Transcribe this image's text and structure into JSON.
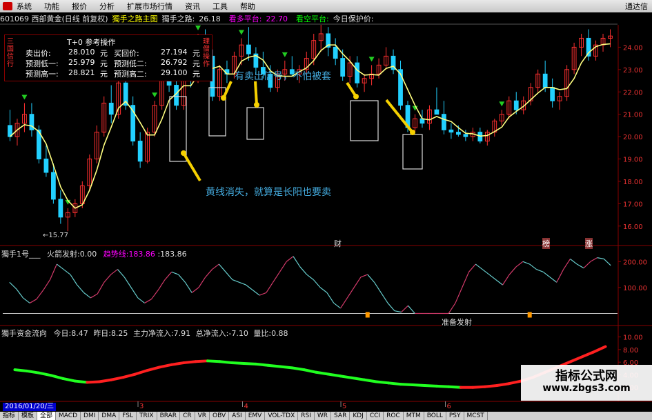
{
  "menu": {
    "items": [
      "系统",
      "功能",
      "报价",
      "分析",
      "扩展市场行情",
      "资讯",
      "工具",
      "帮助"
    ],
    "brand": "通达信"
  },
  "header": {
    "code_name": "601069 西部黄金(日线 前复权)",
    "main_label": "獨手之路主图",
    "main_value_label": "獨手之路:",
    "main_value": "26.18",
    "long_label": "看多平台:",
    "long_value": "22.70",
    "short_label": "看空平台:",
    "protect_label": "今日保护价:"
  },
  "panel": {
    "title": "T+0 参考操作",
    "left_vertical": "三国信行",
    "right_vertical": "理僧操作",
    "rows": [
      {
        "l_label": "卖出价:",
        "l_value": "28.010",
        "l_unit": "元",
        "r_label": "买回价:",
        "r_value": "27.194",
        "r_unit": "元"
      },
      {
        "l_label": "预测低一:",
        "l_value": "25.979",
        "l_unit": "元",
        "r_label": "预测低二:",
        "r_value": "26.792",
        "r_unit": "元"
      },
      {
        "l_label": "预测高一:",
        "l_value": "28.821",
        "l_unit": "元",
        "r_label": "预测高二:",
        "r_value": "29.100",
        "r_unit": "元"
      }
    ]
  },
  "annotations": {
    "sell_signal": "有卖出信号，不怕被套",
    "yellow_line": "黄线消失，就算是长阳也要卖"
  },
  "indicator1": {
    "name": "獨手1号___",
    "fire_label": "火箭发射:",
    "fire_value": "0.00",
    "trend_label": "趋势线:",
    "trend_value": "183.86",
    "trend_value2": "183.86",
    "ready_label": "准备发射"
  },
  "indicator2": {
    "name": "獨手资金流向",
    "today_label": "今日:",
    "today": "8.47",
    "yest_label": "昨日:",
    "yest": "8.25",
    "main_label": "主力净流入:",
    "main": "7.91",
    "total_label": "总净流入:",
    "total": "-7.10",
    "ratio_label": "量比:",
    "ratio": "0.88"
  },
  "date_label": "2016/01/20/三",
  "markers": {
    "low": "←15.77",
    "cai": "财",
    "bang": "榜",
    "zhang": "涨"
  },
  "bottom_tabs": [
    "指标",
    "模板",
    "全部",
    "MACD",
    "DMI",
    "DMA",
    "FSL",
    "TRIX",
    "BRAR",
    "CR",
    "VR",
    "OBV",
    "ASI",
    "EMV",
    "VOL-TDX",
    "RSI",
    "WR",
    "SAR",
    "KDJ",
    "CCI",
    "ROC",
    "MTM",
    "BOLL",
    "PSY",
    "MCST"
  ],
  "watermark": {
    "title": "指标公式网",
    "url": "www.zbgs3.com"
  },
  "colors": {
    "up": "#ff3030",
    "down": "#22d0ff",
    "trend": "#ffff80",
    "flow_up": "#ff2020",
    "flow_down": "#20ff20"
  },
  "chart_data": [
    {
      "type": "candlestick",
      "title": "",
      "ylim": [
        15.5,
        25.0
      ],
      "yticks": [
        16.0,
        17.0,
        18.0,
        19.0,
        20.0,
        21.0,
        22.0,
        23.0,
        24.0
      ],
      "xticks": [
        "3",
        "4",
        "5",
        "6"
      ],
      "candles": [
        [
          20.5,
          21.2,
          19.8,
          20.0
        ],
        [
          20.0,
          20.8,
          19.6,
          20.6
        ],
        [
          20.6,
          21.5,
          20.2,
          21.0
        ],
        [
          21.0,
          21.5,
          20.0,
          20.3
        ],
        [
          20.3,
          20.5,
          18.8,
          19.0
        ],
        [
          19.0,
          19.6,
          18.2,
          18.4
        ],
        [
          18.4,
          18.8,
          17.0,
          17.2
        ],
        [
          17.2,
          17.6,
          16.1,
          16.4
        ],
        [
          16.4,
          16.8,
          15.77,
          16.6
        ],
        [
          16.6,
          17.2,
          16.4,
          17.0
        ],
        [
          17.0,
          18.0,
          16.8,
          17.8
        ],
        [
          17.8,
          19.2,
          17.6,
          19.0
        ],
        [
          19.0,
          20.5,
          18.8,
          20.2
        ],
        [
          20.2,
          21.8,
          20.0,
          21.5
        ],
        [
          21.5,
          22.3,
          20.6,
          21.0
        ],
        [
          21.0,
          22.6,
          20.8,
          22.4
        ],
        [
          22.4,
          22.8,
          21.2,
          21.4
        ],
        [
          21.4,
          21.8,
          19.6,
          19.8
        ],
        [
          19.8,
          20.2,
          18.6,
          18.9
        ],
        [
          18.9,
          20.4,
          18.8,
          20.2
        ],
        [
          20.2,
          21.6,
          20.0,
          21.4
        ],
        [
          21.4,
          22.8,
          21.2,
          22.6
        ],
        [
          22.6,
          23.6,
          22.0,
          22.3
        ],
        [
          22.3,
          23.2,
          21.2,
          21.4
        ],
        [
          21.4,
          23.0,
          21.2,
          22.8
        ],
        [
          22.8,
          23.6,
          22.2,
          22.6
        ],
        [
          22.6,
          24.6,
          22.4,
          24.2
        ],
        [
          24.2,
          24.8,
          23.2,
          23.6
        ],
        [
          23.6,
          23.9,
          21.6,
          21.8
        ],
        [
          21.8,
          23.2,
          21.6,
          23.0
        ],
        [
          23.0,
          23.4,
          22.4,
          22.8
        ],
        [
          22.8,
          23.8,
          22.6,
          23.6
        ],
        [
          23.6,
          24.4,
          23.2,
          24.1
        ],
        [
          24.1,
          24.9,
          23.4,
          23.7
        ],
        [
          23.7,
          24.0,
          22.8,
          23.1
        ],
        [
          23.1,
          23.8,
          22.6,
          22.8
        ],
        [
          22.8,
          23.2,
          22.0,
          22.2
        ],
        [
          22.2,
          23.0,
          22.0,
          22.8
        ],
        [
          22.8,
          23.4,
          22.5,
          23.0
        ],
        [
          23.0,
          23.6,
          22.7,
          22.8
        ],
        [
          22.8,
          23.2,
          22.4,
          23.0
        ],
        [
          23.0,
          23.8,
          22.8,
          23.5
        ],
        [
          23.5,
          24.6,
          23.2,
          24.3
        ],
        [
          24.3,
          25.0,
          23.8,
          24.6
        ],
        [
          24.6,
          24.9,
          23.6,
          24.0
        ],
        [
          24.0,
          24.4,
          23.2,
          23.5
        ],
        [
          23.5,
          23.9,
          22.5,
          22.7
        ],
        [
          22.7,
          23.6,
          22.4,
          23.3
        ],
        [
          23.3,
          23.6,
          22.2,
          22.4
        ],
        [
          22.4,
          22.8,
          22.0,
          22.6
        ],
        [
          22.6,
          23.2,
          22.3,
          22.8
        ],
        [
          22.8,
          23.5,
          22.6,
          23.2
        ],
        [
          23.2,
          24.0,
          23.0,
          23.6
        ],
        [
          23.6,
          23.9,
          22.8,
          23.0
        ],
        [
          23.0,
          23.4,
          21.2,
          21.4
        ],
        [
          21.4,
          21.6,
          20.2,
          20.4
        ],
        [
          20.4,
          21.0,
          20.2,
          20.8
        ],
        [
          20.8,
          21.2,
          20.4,
          20.6
        ],
        [
          20.6,
          21.4,
          20.3,
          21.2
        ],
        [
          21.2,
          22.2,
          21.0,
          21.0
        ],
        [
          21.0,
          21.6,
          20.1,
          20.3
        ],
        [
          20.3,
          20.6,
          19.9,
          20.2
        ],
        [
          20.2,
          20.5,
          20.0,
          20.1
        ],
        [
          20.1,
          20.3,
          19.8,
          20.0
        ],
        [
          20.0,
          20.4,
          19.8,
          20.2
        ],
        [
          20.2,
          20.4,
          19.7,
          19.8
        ],
        [
          19.8,
          20.3,
          19.6,
          20.2
        ],
        [
          20.2,
          20.8,
          20.0,
          20.7
        ],
        [
          20.7,
          21.2,
          20.5,
          21.0
        ],
        [
          21.0,
          21.8,
          20.8,
          21.6
        ],
        [
          21.6,
          22.0,
          21.0,
          21.2
        ],
        [
          21.2,
          21.8,
          21.0,
          21.6
        ],
        [
          21.6,
          22.4,
          21.4,
          22.2
        ],
        [
          22.2,
          23.0,
          22.0,
          22.8
        ],
        [
          22.8,
          23.4,
          22.0,
          22.2
        ],
        [
          22.2,
          22.6,
          21.3,
          21.6
        ],
        [
          21.6,
          22.0,
          21.2,
          21.8
        ],
        [
          21.8,
          23.2,
          21.6,
          23.0
        ],
        [
          23.0,
          24.2,
          22.8,
          24.0
        ],
        [
          24.0,
          24.6,
          23.6,
          24.4
        ],
        [
          24.4,
          24.8,
          23.4,
          23.6
        ],
        [
          23.6,
          24.3,
          23.4,
          24.1
        ],
        [
          24.1,
          24.6,
          23.8,
          24.4
        ],
        [
          24.4,
          24.8,
          24.0,
          24.5
        ]
      ]
    },
    {
      "type": "line",
      "title": "",
      "ylim": [
        -20,
        230
      ],
      "yticks": [
        100.0,
        200.0
      ],
      "values": [
        120,
        95,
        60,
        40,
        55,
        90,
        130,
        190,
        170,
        150,
        110,
        80,
        60,
        75,
        120,
        150,
        170,
        140,
        100,
        60,
        40,
        55,
        90,
        130,
        160,
        150,
        120,
        80,
        100,
        140,
        170,
        190,
        160,
        130,
        120,
        110,
        90,
        70,
        80,
        120,
        160,
        200,
        220,
        180,
        150,
        130,
        100,
        80,
        40,
        20,
        60,
        100,
        140,
        150,
        120,
        80,
        40,
        10,
        5,
        30,
        0,
        0,
        0,
        0,
        0,
        0,
        40,
        100,
        160,
        190,
        170,
        150,
        130,
        110,
        150,
        180,
        200,
        190,
        170,
        160,
        140,
        120,
        170,
        210,
        190,
        175,
        200,
        215,
        210,
        185
      ],
      "signal_bars": [
        53,
        77
      ]
    },
    {
      "type": "area",
      "title": "",
      "ylim": [
        0,
        10.5
      ],
      "yticks": [
        2.0,
        4.0,
        6.0,
        8.0,
        10.0
      ],
      "values": [
        4.8,
        4.6,
        4.3,
        3.9,
        3.4,
        3.0,
        2.8,
        2.9,
        3.2,
        3.6,
        4.1,
        4.7,
        5.2,
        5.6,
        5.9,
        6.1,
        6.2,
        6.1,
        5.9,
        5.8,
        5.7,
        5.5,
        5.3,
        5.1,
        4.8,
        4.4,
        4.1,
        3.8,
        3.5,
        3.2,
        2.9,
        2.7,
        2.5,
        2.4,
        2.3,
        2.2,
        2.1,
        2.0,
        2.0,
        2.1,
        2.3,
        2.6,
        3.0,
        3.6,
        4.4,
        5.2,
        6.0,
        6.8,
        7.6,
        8.47
      ]
    }
  ]
}
